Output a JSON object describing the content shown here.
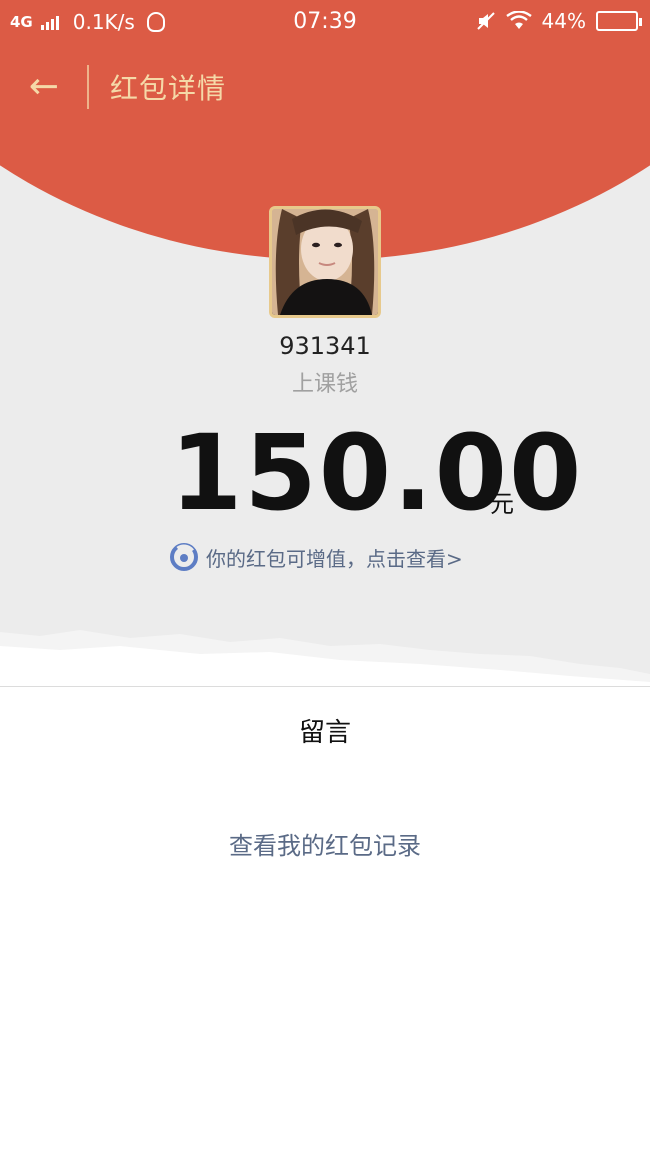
{
  "status_bar": {
    "network": "4G",
    "speed": "0.1K/s",
    "time": "07:39",
    "battery": "44%",
    "icons": [
      "signal-icon",
      "qq-icon",
      "mute-icon",
      "wifi-icon",
      "battery-icon"
    ]
  },
  "nav": {
    "back_icon": "←",
    "title": "红包详情"
  },
  "packet": {
    "sender": "931341",
    "memo": "上课钱",
    "amount": "150.00",
    "unit": "元",
    "promo_text": "你的红包可增值，点击查看>"
  },
  "footer": {
    "comment_label": "留言",
    "records_link": "查看我的红包记录"
  },
  "colors": {
    "header_red": "#dc5b45",
    "gold": "#f5d9a8",
    "link": "#5a6a86",
    "page_gray": "#ececec"
  }
}
